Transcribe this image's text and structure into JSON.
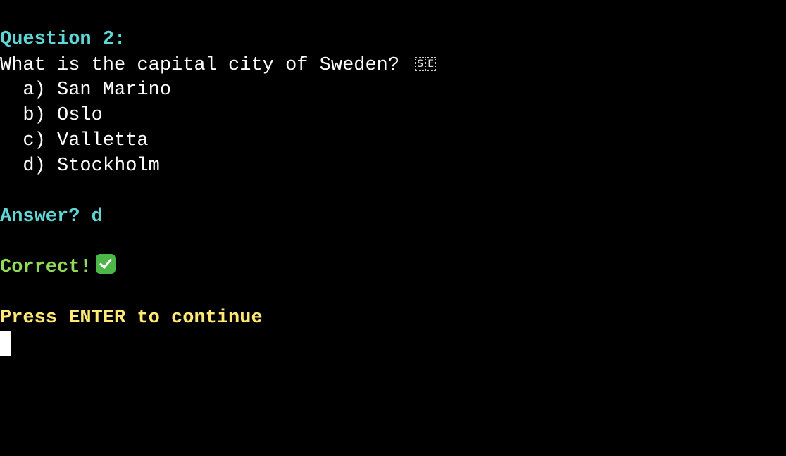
{
  "terminal": {
    "question_heading": "Question 2:",
    "question_text": "What is the capital city of Sweden?",
    "flag_letters": [
      "S",
      "E"
    ],
    "options": [
      "  a) San Marino",
      "  b) Oslo",
      "  c) Valletta",
      "  d) Stockholm"
    ],
    "answer_prompt": "Answer? d",
    "result_text": "Correct!",
    "result_icon": "check-mark-icon",
    "continue_prompt": "Press ENTER to continue"
  },
  "colors": {
    "background": "#000000",
    "heading": "#5fd7d7",
    "correct": "#8fdc5a",
    "prompt": "#ffe873",
    "text": "#ffffff"
  }
}
